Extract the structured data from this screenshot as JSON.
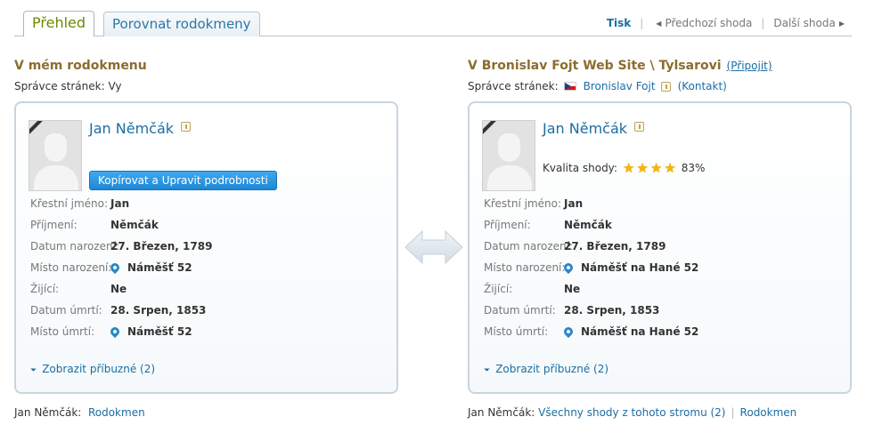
{
  "tabs": [
    {
      "label": "Přehled"
    },
    {
      "label": "Porovnat rodokmeny"
    }
  ],
  "toplinks": {
    "print": "Tisk",
    "prev": "Předchozí shoda",
    "next": "Další shoda"
  },
  "left": {
    "title": "V mém rodokmenu",
    "manager_label": "Správce stránek:",
    "manager_value": "Vy",
    "person": {
      "name": "Jan Němčák",
      "copy_button": "Kopírovat a Upravit podrobnosti",
      "facts": [
        {
          "label": "Křestní jméno:",
          "value": "Jan"
        },
        {
          "label": "Příjmení:",
          "value": "Němčák"
        },
        {
          "label": "Datum narození:",
          "value": "27. Březen, 1789"
        },
        {
          "label": "Místo narození:",
          "value": "Náměšť 52"
        },
        {
          "label": "Žijící:",
          "value": "Ne"
        },
        {
          "label": "Datum úmrtí:",
          "value": "28. Srpen, 1853"
        },
        {
          "label": "Místo úmrtí:",
          "value": "Náměšť 52"
        }
      ],
      "relatives": "Zobrazit příbuzné (2)"
    },
    "footer_name": "Jan Němčák:",
    "footer_link": "Rodokmen"
  },
  "right": {
    "title": "V Bronislav Fojt Web Site \\ Tylsarovi",
    "join": "(Připojit)",
    "manager_label": "Správce stránek:",
    "manager_value": "Bronislav Fojt",
    "contact": "(Kontakt)",
    "person": {
      "name": "Jan Němčák",
      "quality_label": "Kvalita shody:",
      "quality_pct": "83%",
      "quality_stars": 4,
      "facts": [
        {
          "label": "Křestní jméno:",
          "value": "Jan"
        },
        {
          "label": "Příjmení:",
          "value": "Němčák"
        },
        {
          "label": "Datum narození:",
          "value": "27. Březen, 1789"
        },
        {
          "label": "Místo narození:",
          "value": "Náměšť na Hané 52"
        },
        {
          "label": "Žijící:",
          "value": "Ne"
        },
        {
          "label": "Datum úmrtí:",
          "value": "28. Srpen, 1853"
        },
        {
          "label": "Místo úmrtí:",
          "value": "Náměšť na Hané 52"
        }
      ],
      "relatives": "Zobrazit příbuzné (2)"
    },
    "footer_name": "Jan Němčák:",
    "footer_link_all": "Všechny shody z tohoto stromu (2)",
    "footer_link": "Rodokmen"
  },
  "colors": {
    "link": "#1a6ea3",
    "heading": "#8a6d30",
    "active_tab": "#6a8a00",
    "button": "#1e87d6",
    "star": "#f4b400"
  },
  "icons": [
    "pin-icon",
    "star-icon",
    "double-arrow-icon",
    "chevron-down-icon",
    "info-icon",
    "czech-flag-icon",
    "triangle-left-icon",
    "triangle-right-icon"
  ]
}
